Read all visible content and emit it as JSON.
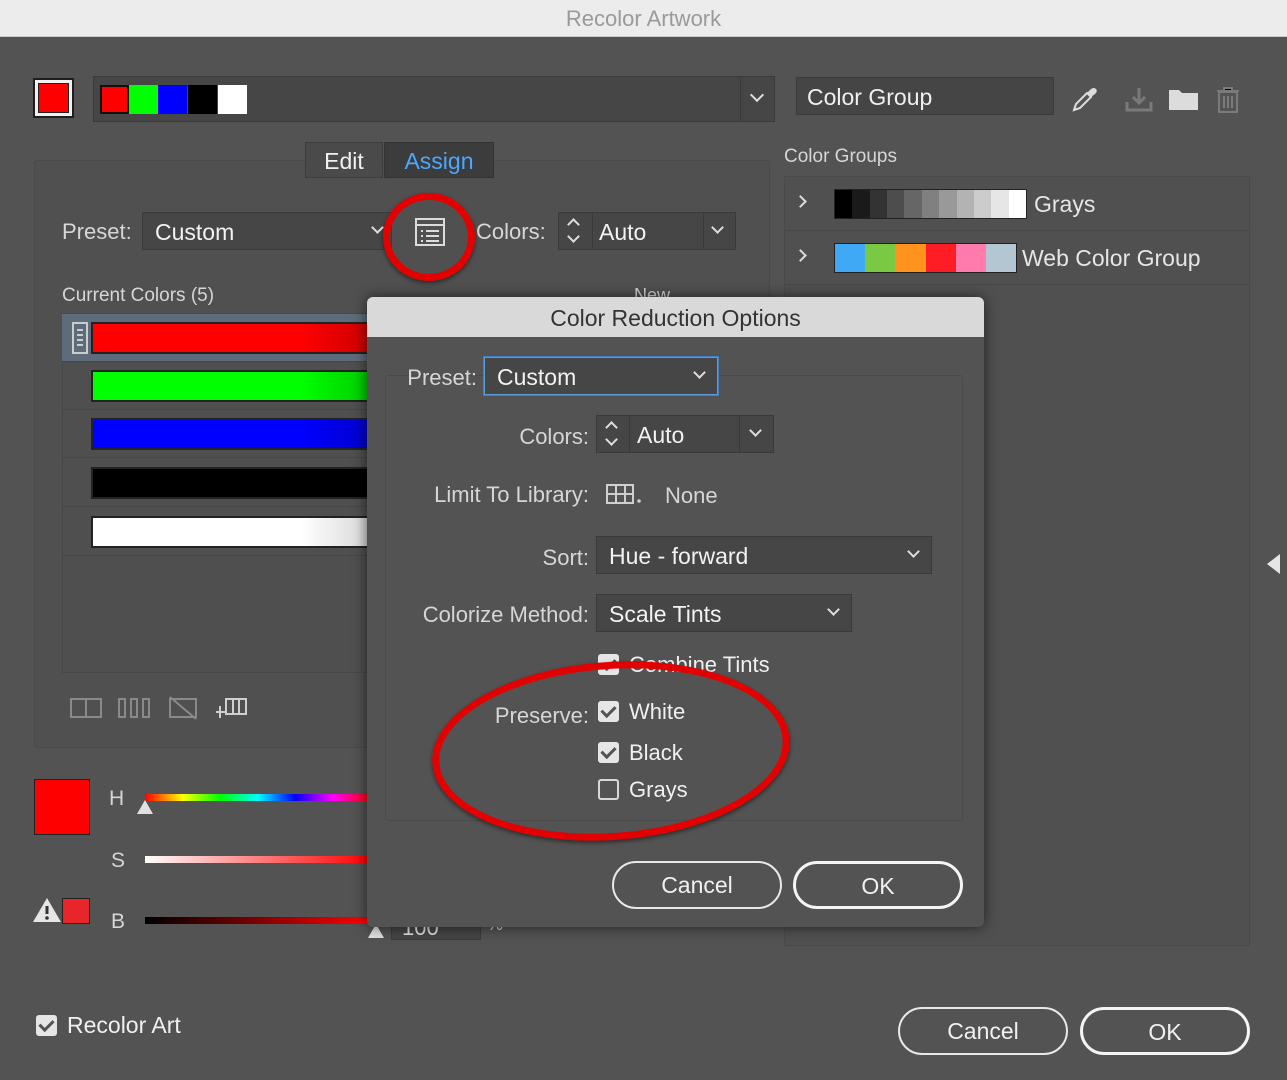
{
  "window": {
    "title": "Recolor Artwork"
  },
  "top": {
    "active_color": "#ff0000",
    "group_colors": [
      "#ff0000",
      "#00ff00",
      "#0000ff",
      "#000000",
      "#ffffff"
    ],
    "color_group_name": "Color Group"
  },
  "tabs": [
    {
      "label": "Edit"
    },
    {
      "label": "Assign"
    }
  ],
  "assign": {
    "preset_label": "Preset:",
    "preset_value": "Custom",
    "colors_label": "Colors:",
    "colors_value": "Auto",
    "current_colors_label": "Current Colors (5)",
    "new_label": "New",
    "rows": [
      {
        "color": "#ff0000"
      },
      {
        "color": "#00ff00"
      },
      {
        "color": "#0000ff"
      },
      {
        "color": "#000000"
      },
      {
        "color": "#ffffff"
      }
    ]
  },
  "sliders": {
    "swatch_color": "#ff0000",
    "h_label": "H",
    "s_label": "S",
    "b_label": "B",
    "b_value": "100",
    "b_unit": "%"
  },
  "color_groups": {
    "heading": "Color Groups",
    "items": [
      {
        "name": "Grays",
        "swatches": [
          "#000000",
          "#1a1a1a",
          "#333333",
          "#4d4d4d",
          "#666666",
          "#808080",
          "#999999",
          "#b3b3b3",
          "#cccccc",
          "#e6e6e6",
          "#ffffff"
        ]
      },
      {
        "name": "Web Color Group",
        "swatches": [
          "#3fa9f5",
          "#7ac943",
          "#ff931e",
          "#ff1d25",
          "#ff7bac",
          "#b3c6d1"
        ]
      }
    ]
  },
  "dialog": {
    "title": "Color Reduction Options",
    "preset_label": "Preset:",
    "preset_value": "Custom",
    "colors_label": "Colors:",
    "colors_value": "Auto",
    "limit_label": "Limit To Library:",
    "limit_value": "None",
    "sort_label": "Sort:",
    "sort_value": "Hue - forward",
    "colorize_label": "Colorize Method:",
    "colorize_value": "Scale Tints",
    "combine_tints": {
      "label": "Combine Tints",
      "checked": true
    },
    "preserve_label": "Preserve:",
    "preserve": [
      {
        "label": "White",
        "checked": true
      },
      {
        "label": "Black",
        "checked": true
      },
      {
        "label": "Grays",
        "checked": false
      }
    ],
    "cancel_label": "Cancel",
    "ok_label": "OK"
  },
  "footer": {
    "recolor_art_label": "Recolor Art",
    "recolor_art_checked": true,
    "cancel_label": "Cancel",
    "ok_label": "OK"
  },
  "annotation_color": "#e30000"
}
